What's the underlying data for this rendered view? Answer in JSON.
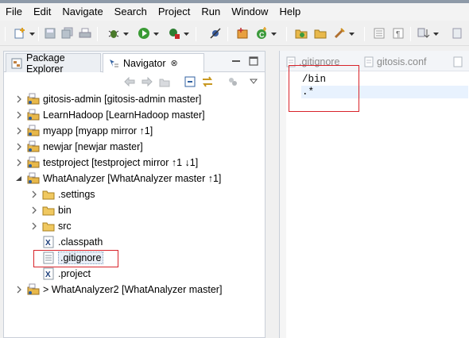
{
  "menubar": {
    "items": [
      "File",
      "Edit",
      "Navigate",
      "Search",
      "Project",
      "Run",
      "Window",
      "Help"
    ]
  },
  "toolbar": {
    "buttons": [
      "new-icon",
      "save-icon",
      "save-all-icon",
      "print-icon",
      "debug-icon",
      "run-icon",
      "external-tools-icon",
      "skip-breakpoints-icon",
      "new-java-project-icon",
      "new-class-icon",
      "open-type-icon",
      "open-task-icon",
      "search-icon",
      "toggle-mark-occurrences-icon",
      "show-whitespace-icon",
      "next-annotation-icon",
      "pin-editor-icon"
    ]
  },
  "navigator_panel": {
    "tabs": [
      {
        "label": "Package Explorer",
        "icon": "package-explorer-icon",
        "active": false
      },
      {
        "label": "Navigator",
        "icon": "navigator-icon",
        "active": true
      }
    ],
    "close_glyph": "⊗",
    "tree": [
      {
        "label": "gitosis-admin [gitosis-admin master]",
        "type": "project",
        "expanded": false
      },
      {
        "label": "LearnHadoop [LearnHadoop master]",
        "type": "project",
        "expanded": false
      },
      {
        "label": "myapp [myapp mirror ↑1]",
        "type": "project",
        "expanded": false
      },
      {
        "label": "newjar [newjar master]",
        "type": "project",
        "expanded": false
      },
      {
        "label": "testproject [testproject mirror ↑1 ↓1]",
        "type": "project",
        "expanded": false
      },
      {
        "label": "WhatAnalyzer [WhatAnalyzer master ↑1]",
        "type": "project",
        "expanded": true
      },
      {
        "label": ".settings",
        "type": "folder",
        "expanded": false
      },
      {
        "label": "bin",
        "type": "folder",
        "expanded": false
      },
      {
        "label": "src",
        "type": "folder",
        "expanded": false
      },
      {
        "label": ".classpath",
        "type": "xml-file"
      },
      {
        "label": ".gitignore",
        "type": "text-file",
        "selected": true
      },
      {
        "label": ".project",
        "type": "xml-file"
      },
      {
        "label": "> WhatAnalyzer2 [WhatAnalyzer master]",
        "type": "project",
        "expanded": false
      }
    ]
  },
  "editor": {
    "tabs": [
      {
        "label": ".gitignore",
        "icon": "text-file-icon"
      },
      {
        "label": "gitosis.conf",
        "icon": "text-file-icon"
      }
    ],
    "lines": [
      "/bin",
      ".*"
    ]
  },
  "colors": {
    "highlight_box": "#d8232a",
    "selection_bg": "#e8eef7",
    "current_line": "#e8f2fe"
  }
}
